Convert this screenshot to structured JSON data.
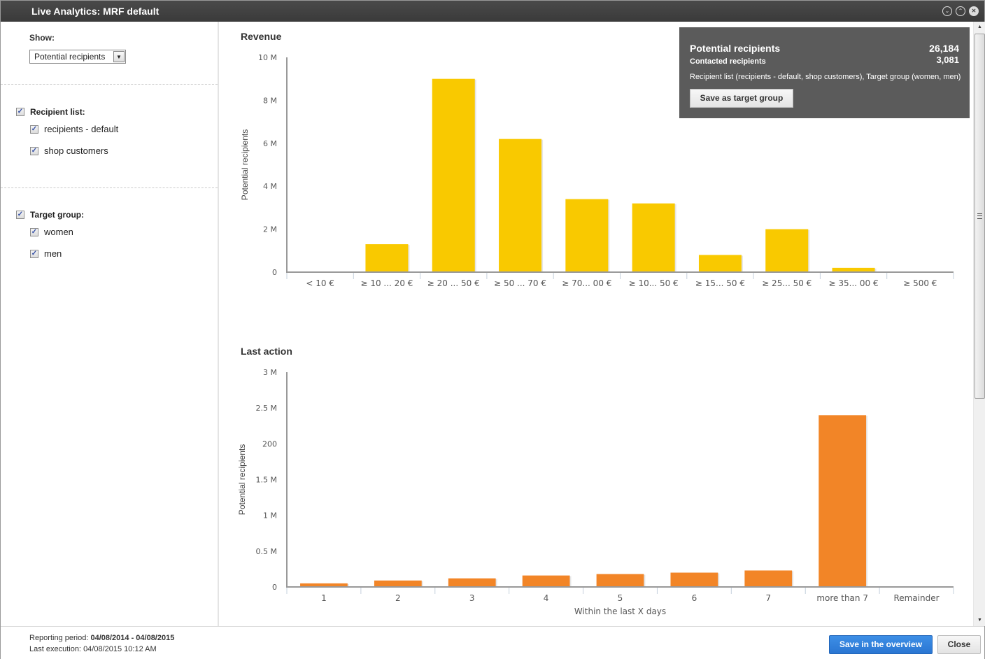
{
  "window": {
    "title": "Live Analytics: MRF default",
    "controls": [
      "collapse-icon",
      "expand-icon",
      "close-icon"
    ]
  },
  "sidebar": {
    "show_label": "Show:",
    "show_select": {
      "value": "Potential recipients"
    },
    "groups": [
      {
        "label": "Recipient list:",
        "checked": true,
        "items": [
          {
            "label": "recipients - default",
            "checked": true
          },
          {
            "label": "shop customers",
            "checked": true
          }
        ]
      },
      {
        "label": "Target group:",
        "checked": true,
        "items": [
          {
            "label": "women",
            "checked": true
          },
          {
            "label": "men",
            "checked": true
          }
        ]
      }
    ]
  },
  "tooltip": {
    "potential_label": "Potential recipients",
    "potential_value": "26,184",
    "contacted_label": "Contacted recipients",
    "contacted_value": "3,081",
    "description": "Recipient list (recipients - default, shop customers), Target group (women, men)",
    "button_label": "Save as target group"
  },
  "chart_data": [
    {
      "type": "bar",
      "title": "Revenue",
      "xlabel": "",
      "ylabel": "Potential recipients",
      "color": "#f9c900",
      "ylim": [
        0,
        10000000
      ],
      "yticks": [
        0,
        2000000,
        4000000,
        6000000,
        8000000,
        10000000
      ],
      "ytick_labels": [
        "0",
        "2 M",
        "4 M",
        "6 M",
        "8 M",
        "10 M"
      ],
      "categories": [
        "< 10 €",
        "≥ 10 ... 20 €",
        "≥ 20 ... 50 €",
        "≥ 50 ... 70 €",
        "≥ 70... 00 €",
        "≥ 10... 50 €",
        "≥ 15... 50 €",
        "≥ 25... 50 €",
        "≥ 35... 00 €",
        "≥ 500 €"
      ],
      "values": [
        0,
        1300000,
        9000000,
        6200000,
        3400000,
        3200000,
        800000,
        2000000,
        200000,
        0
      ],
      "grid": false,
      "legend": "none"
    },
    {
      "type": "bar",
      "title": "Last action",
      "xlabel": "Within the last X days",
      "ylabel": "Potential recipients",
      "color": "#f28527",
      "ylim": [
        0,
        3000000
      ],
      "yticks": [
        0,
        500000,
        1000000,
        1500000,
        2000000,
        2500000,
        3000000
      ],
      "ytick_labels": [
        "0",
        "0.5 M",
        "1 M",
        "1.5 M",
        "200",
        "2.5 M",
        "3 M"
      ],
      "categories": [
        "1",
        "2",
        "3",
        "4",
        "5",
        "6",
        "7",
        "more than 7",
        "Remainder"
      ],
      "values": [
        50000,
        90000,
        120000,
        160000,
        180000,
        200000,
        230000,
        2400000,
        0
      ],
      "grid": false,
      "legend": "none"
    }
  ],
  "footer": {
    "reporting_label": "Reporting period: ",
    "reporting_value": "04/08/2014 - 04/08/2015",
    "last_exec_label": "Last execution: ",
    "last_exec_value": "04/08/2015 10:12 AM",
    "save_button": "Save in the overview",
    "close_button": "Close"
  }
}
